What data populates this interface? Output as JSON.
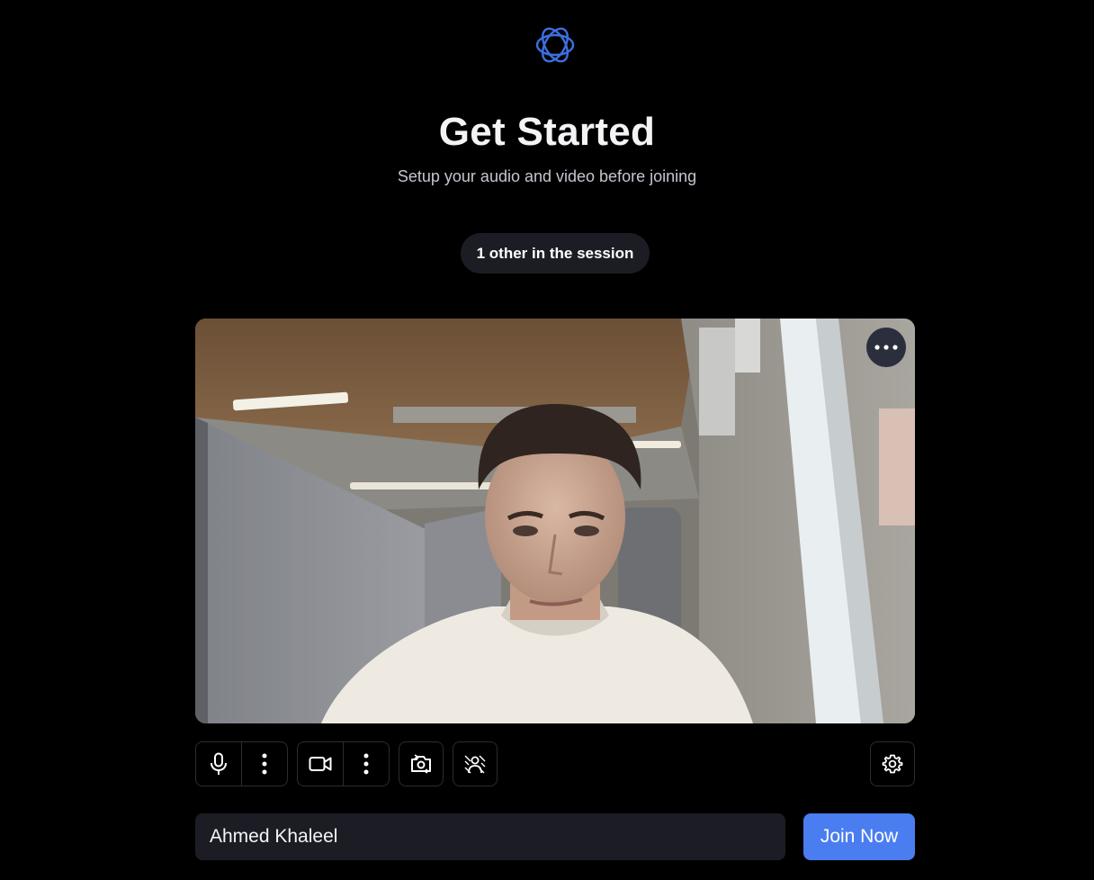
{
  "app": {
    "logo_icon": "infinity-knot-logo"
  },
  "header": {
    "title": "Get Started",
    "subtitle": "Setup your audio and video before joining"
  },
  "session": {
    "participants_label": "1 other in the session"
  },
  "preview": {
    "more_options_icon": "ellipsis-icon"
  },
  "controls": {
    "microphone_icon": "microphone-icon",
    "mic_options_icon": "vertical-dots-icon",
    "camera_icon": "video-camera-icon",
    "camera_options_icon": "vertical-dots-icon",
    "switch_camera_icon": "switch-camera-icon",
    "background_blur_icon": "background-blur-icon",
    "settings_icon": "gear-icon"
  },
  "join": {
    "name_value": "Ahmed Khaleel",
    "join_label": "Join Now"
  },
  "colors": {
    "background": "#000000",
    "surface": "#1c1d24",
    "accent": "#4a7df0",
    "logo": "#3d6fe0"
  }
}
